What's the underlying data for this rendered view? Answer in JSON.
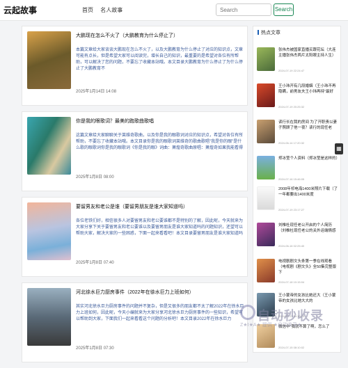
{
  "header": {
    "logo": "云起故事",
    "nav": [
      "首页",
      "名人故事"
    ],
    "search_placeholder": "Search",
    "search_button": "Search"
  },
  "articles": [
    {
      "title": "大鹏现在怎么不火了（大鹏教育为什么停止了）",
      "excerpt": "本篇文章给大家谈谈大鹏现在怎么不火了，以及大鹏教育为什么停止了对应的知识点，文章可能有点长，但是希望大家可以阅读完，增长自己的知识，最重要的是希望对各位有所帮助，可以解决了您的问题，不要忘了收藏本站哦。本文目录大鹏教育为什么停止了为什么停止了大鹏教育不",
      "date": "2025年1月14日 14:08",
      "thumb": "#b5813a"
    },
    {
      "title": "你是我的眼歌词？最美的跑歌曲歌唱",
      "excerpt": "这篇文章给大家聊聊关于莱维奇歌曲，以及你是我的眼歌词对应的知识点，希望对各位有所帮助，不要忘了收藏本站哦。本文目录你是我的眼歌词莱维奇的歌曲歌唱\"我是你的眼\"是什么歌的眼歌词你是我的眼歌词《你是我的眼》词曲：萧煌奇歌曲原唱：萧煌奇如果我能看得",
      "date": "2025年1月8日 08:00",
      "thumb": "#3a8f8a"
    },
    {
      "title": "要留男友和老公是谁（要留男朋友是谁大家知道吗）",
      "excerpt": "各位老铁们好，相信很多人对要留男友和老公要谁都不是特别的了解，因此呢，今天就来为大家分享下关于要留男友和老公要谁以及要留男朋友是谁大家知道吗的问题知识，还望可以帮助大家，解决大家的一些困惑，下面一起来看看吧！本文目录要留男朋友是谁大家知道吗",
      "date": "2025年1月8日 07:40",
      "thumb": "#8fa6c9"
    },
    {
      "title": "河北徐水巨力厨房事件（2022年在徐水巨力上班如何）",
      "excerpt": "其实河北徐水巨力厨房事件的问题并不复杂，但是又很多的朋友都不太了解2022年在徐水巨力上班如何，因此呢，今天小编就来为大家分享河北徐水巨力厨房事件的一些知识，希望可以帮助到大家，下面我们一起来看看这个问题的分析吧！本文目录2022年在徐水巨力",
      "date": "2025年1月8日 07:30",
      "thumb": "#6c7a86"
    }
  ],
  "sidebar": {
    "heading": "热点文章",
    "items": [
      {
        "title": "张伟杰被国家直播买跟花坛（大连主播张伟杰两片太阳眼主持人生）",
        "date": "2024-07-19 22:24:47",
        "thumb": "#7a9a4a"
      },
      {
        "title": "王小玮开有几段婚姻（王小玮不再隐瞒，前男友夫王小玮再持\"最好",
        "date": "2024-07-19 20:25:32",
        "thumb": "#b23a2a"
      },
      {
        "title": "读行长在我的房间 为了开职责以妻子照顾了他一夜？读行的现任老",
        "date": "2024-06-14 17:20:32",
        "thumb": "#9a7a5a"
      },
      {
        "title": "郑冰莹个人资料（郑冰莹是这样的）",
        "date": "2024-07-16 15:46:05",
        "thumb": "#5aa64a"
      },
      {
        "title": "2008年祁电海1400米照片下载（了一年都要出1400米度",
        "date": "2024-07-19 23:17:27",
        "thumb": "#f2f2f2"
      },
      {
        "title": "刘椎杜现任老公开启的个人简历（刘椎杜现任老公的关外运端情感",
        "date": "2024-06-16 02:25:40",
        "thumb": "#7a4a8a"
      },
      {
        "title": "电视剧剧文头条第一季在线观看（电视剧《剧文头》全50集完整版下",
        "date": "2024-07-18 10:15:04",
        "thumb": "#c96a4a"
      },
      {
        "title": "王小蒙帝的女孩比她还大（王小蒙帝的女孩比她大大的",
        "date": "2024-07-17 09:10:20",
        "thumb": "#4a6a8a"
      },
      {
        "title": "微信中\"我就不算了啊，怎么了",
        "date": "2024-07-15 08:10:02",
        "thumb": "#e0c090"
      }
    ]
  },
  "watermark": {
    "main": "自动秒收录",
    "sub": "Z★Ⅰ★A★ 提供 ★自动收录★"
  },
  "colors": {
    "accent": "#198754",
    "excerpt": "#3a5a9a",
    "sidebar_bar": "#1a5fb4"
  }
}
